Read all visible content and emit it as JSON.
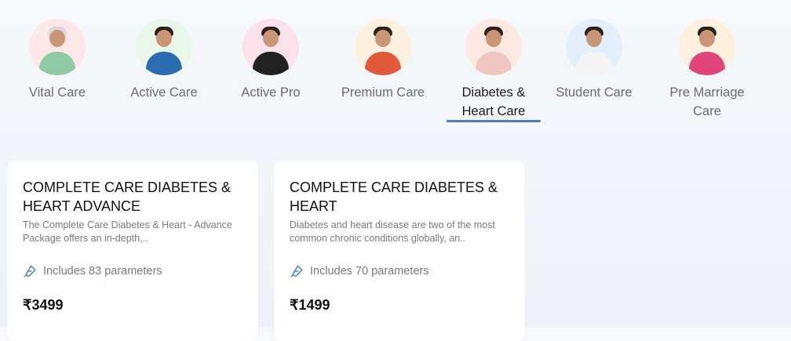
{
  "tabs": [
    {
      "label": "Vital Care",
      "avatar": "couple-elderly-photo",
      "bg": "#fde7e7"
    },
    {
      "label": "Active Care",
      "avatar": "man-smiling-photo",
      "bg": "#e8f7ea"
    },
    {
      "label": "Active Pro",
      "avatar": "woman-fitness-photo",
      "bg": "#fbe1ea"
    },
    {
      "label": "Premium Care",
      "avatar": "family-photo",
      "bg": "#fdf0df"
    },
    {
      "label": "Diabetes & Heart Care",
      "avatar": "woman-heart-hands-photo",
      "bg": "#fde9e2",
      "active": true
    },
    {
      "label": "Student Care",
      "avatar": "student-woman-photo",
      "bg": "#e3f0fc"
    },
    {
      "label": "Pre Marriage Care",
      "avatar": "couple-photo",
      "bg": "#fdf0df"
    }
  ],
  "cards": [
    {
      "title": "COMPLETE CARE DIABETES & HEART ADVANCE",
      "description": "The Complete Care Diabetes & Heart - Advance Package offers an in-depth,..",
      "params": "Includes 83 parameters",
      "price": "₹3499"
    },
    {
      "title": "COMPLETE CARE DIABETES & HEART",
      "description": "Diabetes and heart disease are two of the most common chronic conditions globally, an..",
      "params": "Includes 70 parameters",
      "price": "₹1499"
    }
  ],
  "colors": {
    "accent": "#4a7fc4",
    "icon": "#4a7fc4"
  }
}
